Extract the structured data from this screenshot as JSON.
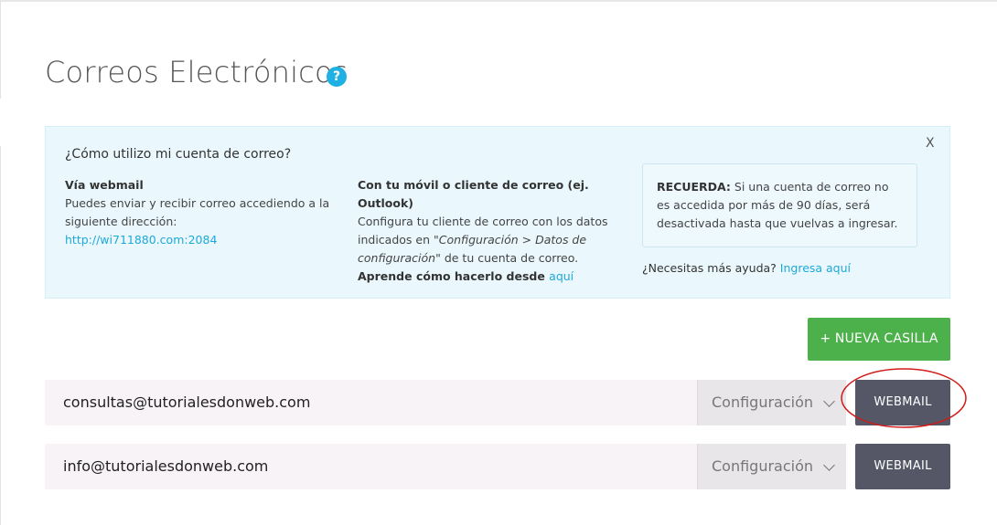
{
  "page": {
    "title": "Correos Electrónicos",
    "help_icon_glyph": "?"
  },
  "info": {
    "close_label": "X",
    "heading": "¿Cómo utilizo mi cuenta de correo?",
    "webmail": {
      "title": "Vía webmail",
      "text": "Puedes enviar y recibir correo accediendo a la siguiente dirección:",
      "link": "http://wi711880.com:2084"
    },
    "client": {
      "title": "Con tu móvil o cliente de correo (ej. Outlook)",
      "text_before": "Configura tu cliente de correo con los datos indicados en ",
      "text_italic": "\"Configuración > Datos de configuración\"",
      "text_after": " de tu cuenta de correo.",
      "learn_text": "Aprende cómo hacerlo desde ",
      "learn_link": "aquí"
    },
    "reminder": {
      "label": "RECUERDA:",
      "text": " Si una cuenta de correo no es accedida por más de 90 días, será desactivada hasta que vuelvas a ingresar."
    },
    "more_help": {
      "text": "¿Necesitas más ayuda? ",
      "link": "Ingresa aquí"
    }
  },
  "actions": {
    "new_mailbox_label": "+ NUEVA CASILLA"
  },
  "accounts": [
    {
      "email": "consultas@tutorialesdonweb.com",
      "config_label": "Configuración",
      "webmail_label": "WEBMAIL"
    },
    {
      "email": "info@tutorialesdonweb.com",
      "config_label": "Configuración",
      "webmail_label": "WEBMAIL"
    }
  ],
  "colors": {
    "accent_blue": "#1fb1e3",
    "green_button": "#4cb04b",
    "webmail_button": "#555766",
    "info_bg": "#eaf8fd",
    "annotation_red": "#d11a1a"
  }
}
